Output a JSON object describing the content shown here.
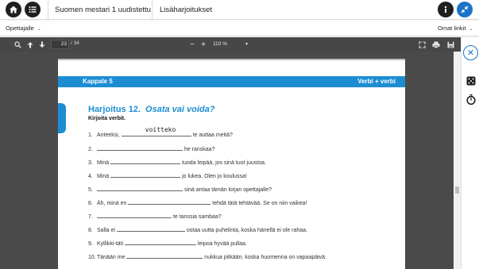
{
  "topbar": {
    "title": "Suomen mestari 1 uudistettu",
    "section": "Lisäharjoitukset",
    "icons": [
      "home-icon",
      "menu-icon",
      "info-icon",
      "collapse-icon"
    ]
  },
  "bar2": {
    "left_dropdown": "Opettajalle",
    "right_dropdown": "Omat linkit"
  },
  "pdf_toolbar": {
    "page_current": "23",
    "page_total": "/ 34",
    "zoom": "110 %",
    "minus": "−",
    "plus": "+"
  },
  "page": {
    "chapter": "Kappale 5",
    "topic": "Verbi + verbi",
    "exercise_number": "Harjoitus 12.",
    "exercise_name": "Osata vai voida?",
    "instruction": "Kirjoita verbit.",
    "items": [
      {
        "n": "1.",
        "before": "Anteeksi, ",
        "answer": "voitteko",
        "after": " te auttaa meitä?"
      },
      {
        "n": "2.",
        "before": "",
        "answer": "",
        "after": " he ranskaa?"
      },
      {
        "n": "3.",
        "before": "Minä ",
        "answer": "",
        "after": " tuoda leipää, jos sinä tuot juustoa."
      },
      {
        "n": "4.",
        "before": "Minä ",
        "answer": "",
        "after": " jo lukea. Olen jo koulussa!"
      },
      {
        "n": "5.",
        "before": "",
        "answer": "",
        "after": " sinä antaa tämän kirjan opettajalle?"
      },
      {
        "n": "6.",
        "before": "Äh, minä en ",
        "answer": "",
        "after": " tehdä tätä tehtävää. Se on niin vaikea!"
      },
      {
        "n": "7.",
        "before": "",
        "answer": "",
        "after": " te tanssia sambaa?"
      },
      {
        "n": "8.",
        "before": "Salla ei ",
        "answer": "",
        "after": " ostaa uutta puhelinta, koska hänellä ei ole rahaa."
      },
      {
        "n": "9.",
        "before": "Kyllikki-täti ",
        "answer": "",
        "after": " leipoa hyvää pullaa."
      },
      {
        "n": "10.",
        "before": "Tänään me ",
        "answer": "",
        "after": " nukkua pitkään, koska huomenna on vapaapäivä."
      }
    ]
  }
}
